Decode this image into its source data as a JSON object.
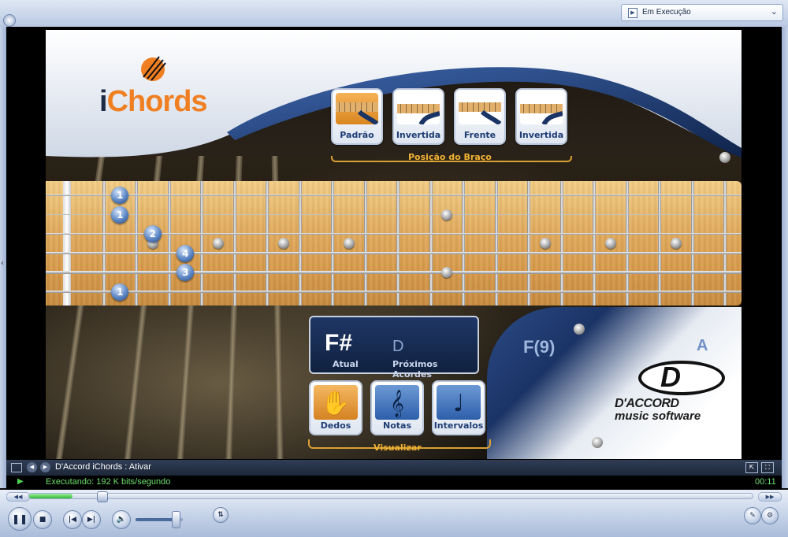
{
  "player": {
    "playlist_label": "Em Execução",
    "media_title": "D'Accord iChords : Ativar",
    "status": "Executando: 192 K bits/segundo",
    "time": "00:11",
    "seek_progress_percent": 6,
    "volume_percent": 85
  },
  "app": {
    "logo": {
      "i": "i",
      "rest": "Chords"
    },
    "position_buttons": [
      {
        "label": "Padrão",
        "active": true
      },
      {
        "label": "Invertida",
        "active": false
      },
      {
        "label": "Frente",
        "active": false
      },
      {
        "label": "Invertida",
        "active": false
      }
    ],
    "position_title": "Posição do Braço",
    "chord": {
      "current": "F#",
      "current_label": "Atual",
      "next": [
        "D",
        "F(9)",
        "A"
      ],
      "next_label": "Próximos Acordes"
    },
    "view_buttons": [
      {
        "label": "Dedos",
        "icon": "hand-icon",
        "active": true
      },
      {
        "label": "Notas",
        "icon": "treble-clef-icon",
        "active": false
      },
      {
        "label": "Intervalos",
        "icon": "note-icon",
        "active": false
      }
    ],
    "view_title": "Visualizar",
    "brand": {
      "letter": "D",
      "name": "D'ACCORD",
      "tagline": "music software"
    },
    "fretboard": {
      "strings": 6,
      "frets": 20,
      "markers": [
        {
          "fret": 3,
          "string": 3.5
        },
        {
          "fret": 5,
          "string": 3.5
        },
        {
          "fret": 7,
          "string": 3.5
        },
        {
          "fret": 9,
          "string": 3.5
        },
        {
          "fret": 12,
          "string": 2
        },
        {
          "fret": 12,
          "string": 5
        },
        {
          "fret": 15,
          "string": 3.5
        },
        {
          "fret": 17,
          "string": 3.5
        },
        {
          "fret": 19,
          "string": 3.5
        }
      ],
      "fingers": [
        {
          "label": "1",
          "fret": 2,
          "string": 1
        },
        {
          "label": "1",
          "fret": 2,
          "string": 2
        },
        {
          "label": "2",
          "fret": 3,
          "string": 3
        },
        {
          "label": "4",
          "fret": 4,
          "string": 4
        },
        {
          "label": "3",
          "fret": 4,
          "string": 5
        },
        {
          "label": "1",
          "fret": 2,
          "string": 6
        }
      ]
    }
  }
}
